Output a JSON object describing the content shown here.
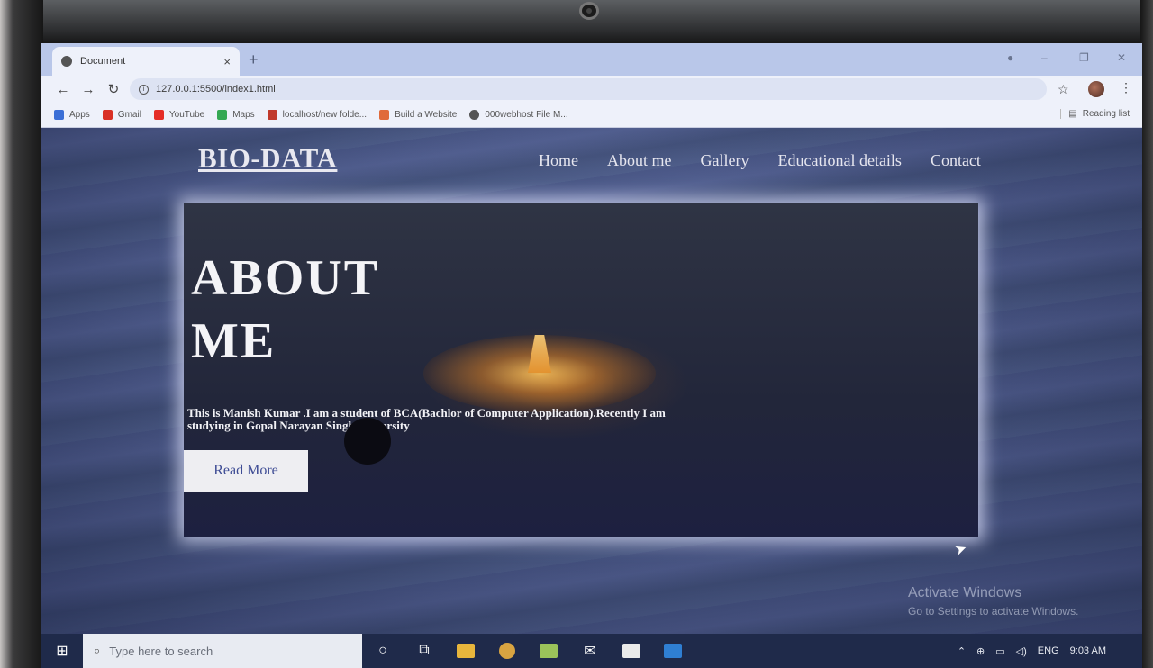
{
  "browser": {
    "tab_title": "Document",
    "tab_close": "×",
    "new_tab": "+",
    "url": "127.0.0.1:5500/index1.html",
    "window_controls": [
      "–",
      "❐",
      "✕"
    ],
    "bookmarks": [
      {
        "label": "Apps",
        "color": "#3b6fd6"
      },
      {
        "label": "Gmail",
        "color": "#d93025"
      },
      {
        "label": "YouTube",
        "color": "#e52d27"
      },
      {
        "label": "Maps",
        "color": "#34a853"
      },
      {
        "label": "localhost/new folde...",
        "color": "#c0392b"
      },
      {
        "label": "Build a Website",
        "color": "#e06a3a"
      },
      {
        "label": "000webhost File M...",
        "color": "#555555"
      }
    ],
    "reading_list": "Reading list"
  },
  "page": {
    "brand": "BIO-DATA",
    "nav": [
      "Home",
      "About me",
      "Gallery",
      "Educational details",
      "Contact"
    ],
    "hero": {
      "title": "ABOUT ME",
      "text": "This is Manish Kumar .I am a student of BCA(Bachlor of Computer Application).Recently I am studying in Gopal Narayan Singh University",
      "button": "Read More"
    }
  },
  "watermark": {
    "line1": "Activate Windows",
    "line2": "Go to Settings to activate Windows."
  },
  "taskbar": {
    "search_placeholder": "Type here to search",
    "language": "ENG",
    "time": "9:03 AM"
  },
  "colors": {
    "accent": "#3f4d95",
    "page_bg": "#4d5c8c"
  }
}
